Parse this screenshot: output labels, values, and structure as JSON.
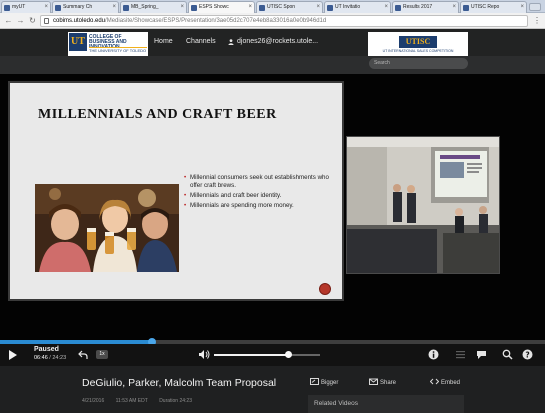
{
  "browser": {
    "tabs": [
      {
        "label": "myUT",
        "active": false
      },
      {
        "label": "Summary Ch",
        "active": false
      },
      {
        "label": "MB_Spring_",
        "active": false
      },
      {
        "label": "ESPS Showc",
        "active": true
      },
      {
        "label": "UTISC Spon",
        "active": false
      },
      {
        "label": "UT Invitatio",
        "active": false
      },
      {
        "label": "Results 2017",
        "active": false
      },
      {
        "label": "UTISC Repo",
        "active": false
      }
    ],
    "url_host": "cobims.utoledo.edu",
    "url_path": "/Mediasite/Showcase/ESPS/Presentation/3ae05d2c707e4eb8a33016a0e0b946d1d"
  },
  "site": {
    "logo_left": {
      "mark": "UT",
      "line1": "COLLEGE OF BUSINESS AND INNOVATION",
      "line2": "THE UNIVERSITY OF TOLEDO"
    },
    "nav": {
      "home": "Home",
      "channels": "Channels",
      "user": "djones26@rockets.utole..."
    },
    "logo_right": {
      "mark": "UTISC",
      "sub": "UT INTERNATIONAL SALES COMPETITION"
    },
    "search_placeholder": "Search"
  },
  "slide": {
    "title": "Millennials and Craft Beer",
    "bullets": [
      "Millennial consumers seek out establishments who offer craft brews.",
      "Millennials and craft beer identity.",
      "Millennials are spending more money."
    ]
  },
  "player": {
    "status": "Paused",
    "current_time": "06:46",
    "duration": "24:23",
    "speed": "1x",
    "progress_percent": 27.8,
    "volume_percent": 70
  },
  "video_info": {
    "title": "DeGiulio, Parker, Malcolm Team Proposal",
    "date": "4/21/2016",
    "time": "11:53 AM EDT",
    "duration_label": "Duration 24:23"
  },
  "actions": {
    "bigger": "Bigger",
    "share": "Share",
    "embed": "Embed"
  },
  "related": {
    "label": "Related Videos"
  },
  "colors": {
    "accent": "#2a8bd2",
    "header_bg": "#222323",
    "ut_blue": "#1c3d6e",
    "ut_gold": "#f2b11c"
  }
}
